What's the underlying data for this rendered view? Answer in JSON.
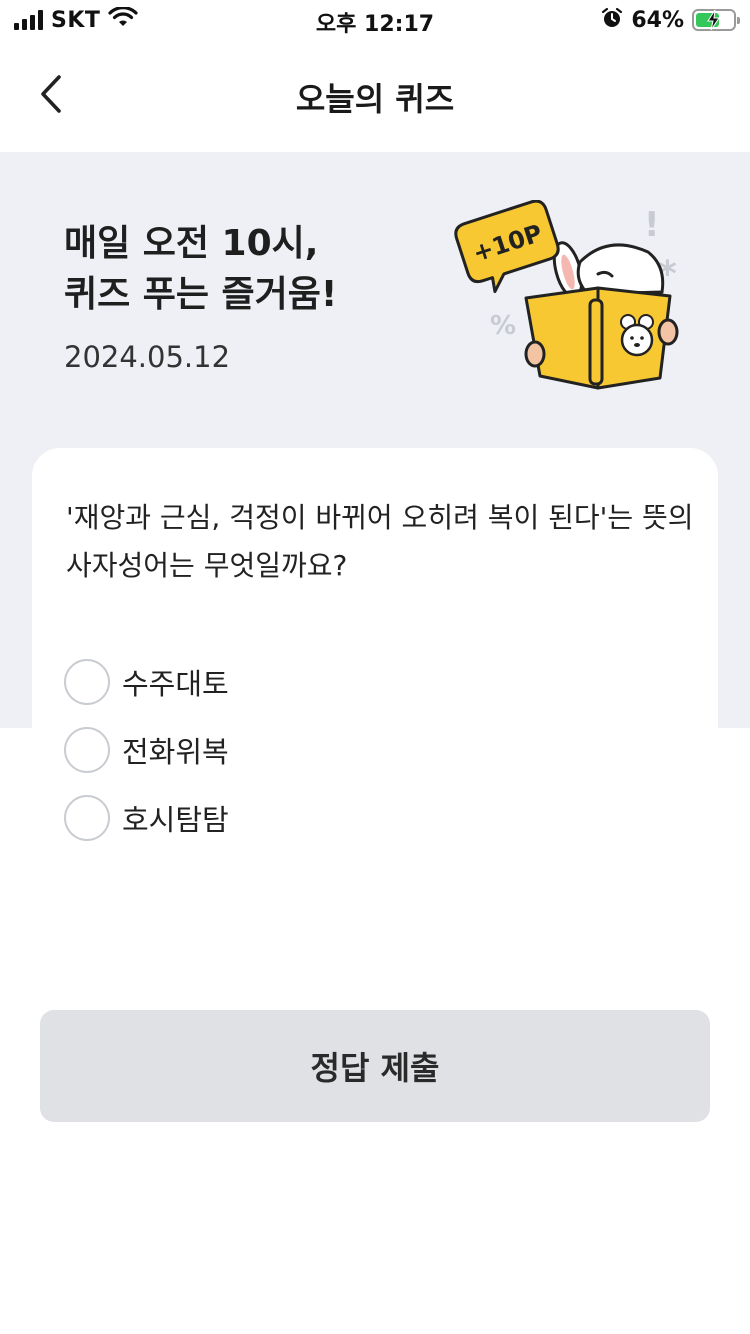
{
  "status_bar": {
    "carrier": "SKT",
    "time": "오후 12:17",
    "battery_percent": "64%",
    "battery_level": 0.64,
    "icons": [
      "signal-icon",
      "wifi-icon",
      "alarm-icon",
      "battery-charging-icon"
    ]
  },
  "nav": {
    "title": "오늘의 퀴즈",
    "back_icon": "chevron-left-icon"
  },
  "hero": {
    "headline": "매일 오전 10시,\n퀴즈 푸는 즐거움!",
    "date": "2024.05.12",
    "badge": "+10P"
  },
  "quiz": {
    "question": "'재앙과 근심, 걱정이 바뀌어 오히려 복이 된다'는 뜻의 사자성어는 무엇일까요?",
    "options": [
      {
        "label": "수주대토"
      },
      {
        "label": "전화위복"
      },
      {
        "label": "호시탐탐"
      }
    ]
  },
  "submit": {
    "label": "정답 제출"
  },
  "colors": {
    "hero_bg": "#eef0f5",
    "button_bg": "#dfe1e5",
    "accent_yellow": "#f7c832",
    "battery_green": "#35c759"
  }
}
